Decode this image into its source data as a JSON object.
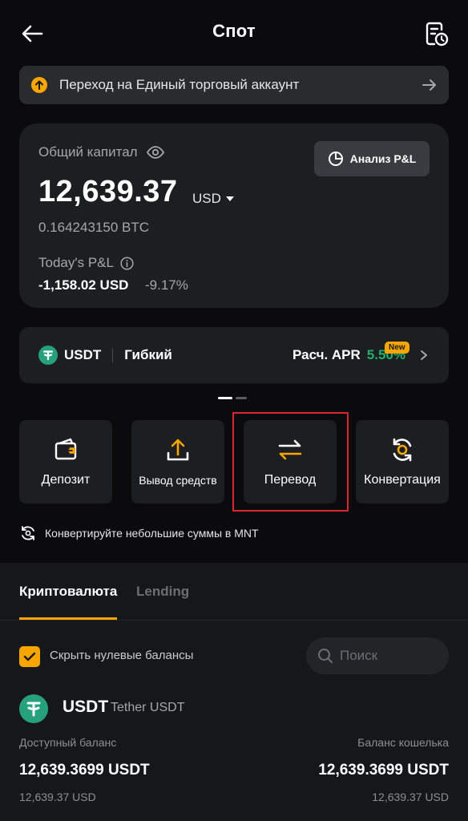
{
  "header": {
    "title": "Спот",
    "back_icon": "arrow-left-icon",
    "history_icon": "order-history-icon"
  },
  "banner": {
    "text": "Переход на Единый торговый аккаунт"
  },
  "capital": {
    "label": "Общий капитал",
    "amount": "12,639.37",
    "currency": "USD",
    "btc_equivalent": "0.164243150 BTC",
    "pnl_button": "Анализ P&L",
    "pnl_label": "Today's P&L",
    "pnl_value": "-1,158.02 USD",
    "pnl_percent": "-9.17%"
  },
  "earn": {
    "asset": "USDT",
    "kind": "Гибкий",
    "apr_label": "Расч. APR",
    "apr_value": "5.50%",
    "badge": "New"
  },
  "actions": {
    "deposit": "Депозит",
    "withdraw": "Вывод средств",
    "transfer": "Перевод",
    "convert": "Конвертация"
  },
  "convert_hint": "Конвертируйте небольшие суммы в MNT",
  "tabs": {
    "crypto": "Криптовалюта",
    "lending": "Lending"
  },
  "filters": {
    "hide_zero_label": "Скрыть нулевые балансы",
    "hide_zero_checked": true,
    "search_placeholder": "Поиск"
  },
  "asset": {
    "symbol": "USDT",
    "name": "Tether USDT",
    "available_label": "Доступный баланс",
    "wallet_label": "Баланс кошелька",
    "available_value": "12,639.3699 USDT",
    "wallet_value": "12,639.3699 USDT",
    "available_usd": "12,639.37 USD",
    "wallet_usd": "12,639.37 USD"
  },
  "colors": {
    "accent": "#f7a600",
    "positive": "#20b26c",
    "highlight": "#d9272e",
    "tether": "#26a17b"
  }
}
